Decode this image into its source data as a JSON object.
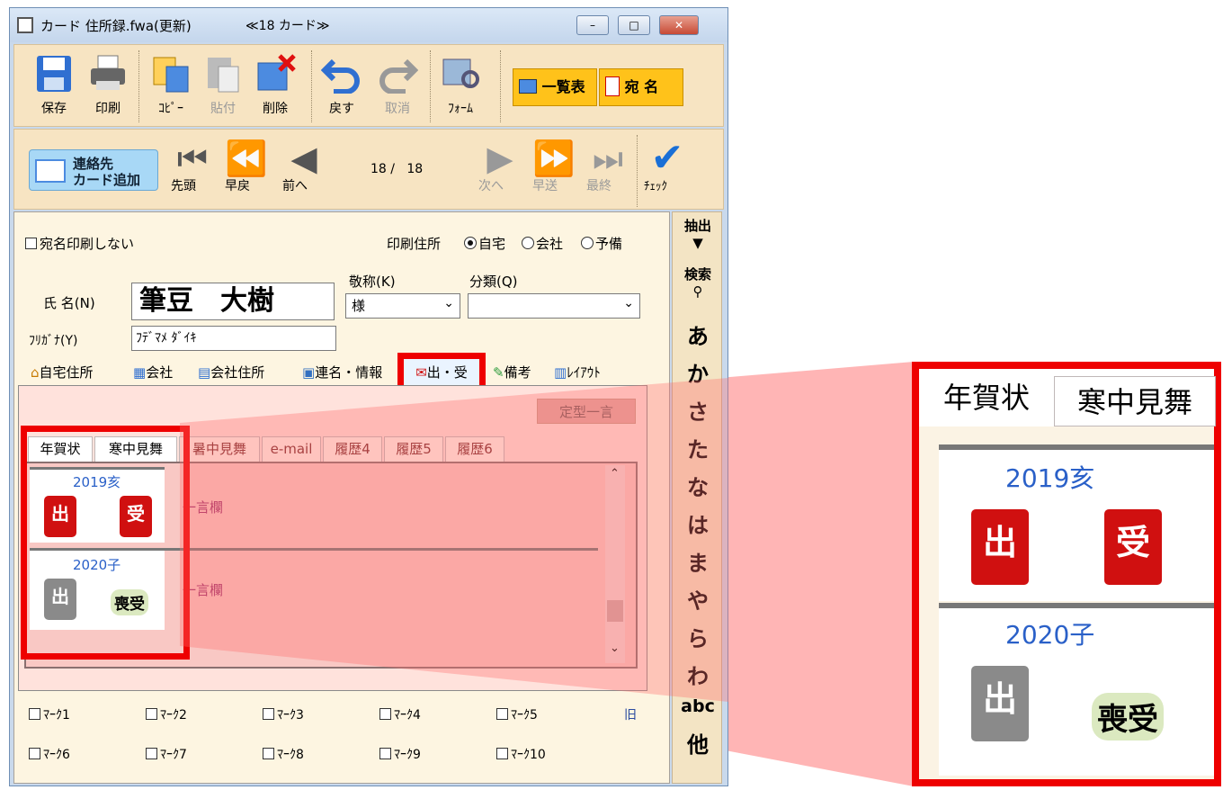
{
  "window": {
    "title": "カード 住所録.fwa(更新)",
    "card_count": "≪18 カード≫",
    "controls": [
      "–",
      "□",
      "✕"
    ]
  },
  "toolbar1": {
    "save": "保存",
    "print": "印刷",
    "copy": "ｺﾋﾟｰ",
    "paste": "貼付",
    "delete": "削除",
    "undo": "戻す",
    "redo": "取消",
    "form": "ﾌｫｰﾑ",
    "list": "一覧表",
    "address": "宛 名"
  },
  "toolbar2": {
    "add_contact_line1": "連絡先",
    "add_contact_line2": "カード追加",
    "first": "先頭",
    "fast_back": "早戻",
    "prev": "前へ",
    "position": "18 /   18",
    "next": "次へ",
    "fast_fwd": "早送",
    "last": "最終",
    "check": "ﾁｪｯｸ"
  },
  "form": {
    "no_print_label": "宛名印刷しない",
    "print_address_label": "印刷住所",
    "radio_home": "自宅",
    "radio_company": "会社",
    "radio_spare": "予備",
    "honorific_label": "敬称(K)",
    "category_label": "分類(Q)",
    "name_label": "氏 名(N)",
    "name_value": "筆豆　大樹",
    "honorific_value": "様",
    "category_value": "",
    "furigana_label": "ﾌﾘｶﾞﾅ(Y)",
    "furigana_value": "ﾌﾃﾞﾏﾒ ﾀﾞｲｷ"
  },
  "tabs": [
    "自宅住所",
    "会社",
    "会社住所",
    "連名・情報",
    "出・受",
    "備考",
    "ﾚｲｱｳﾄ"
  ],
  "fixed_phrase_button": "定型一言",
  "subtabs": [
    "年賀状",
    "寒中見舞",
    "暑中見舞",
    "e-mail",
    "履歴4",
    "履歴5",
    "履歴6"
  ],
  "records": [
    {
      "year": "2019亥",
      "sent": "出",
      "received": "受",
      "note": "一言欄"
    },
    {
      "year": "2020子",
      "sent": "出",
      "received": "喪受",
      "note": "一言欄"
    }
  ],
  "marks": [
    "ﾏｰｸ1",
    "ﾏｰｸ2",
    "ﾏｰｸ3",
    "ﾏｰｸ4",
    "ﾏｰｸ5",
    "ﾏｰｸ6",
    "ﾏｰｸ7",
    "ﾏｰｸ8",
    "ﾏｰｸ9",
    "ﾏｰｸ10"
  ],
  "marks_icon": "旧",
  "sidebar": {
    "extract": "抽出",
    "search": "検索",
    "kana": [
      "あ",
      "か",
      "さ",
      "た",
      "な",
      "は",
      "ま",
      "や",
      "ら",
      "わ",
      "abc",
      "他"
    ]
  },
  "zoom": {
    "tabs": [
      "年賀状",
      "寒中見舞"
    ],
    "year1": "2019亥",
    "year2": "2020子",
    "sent": "出",
    "received": "受",
    "mourning_received": "喪受"
  },
  "colors": {
    "highlight": "#ee0000",
    "overlay": "#ff6e6e",
    "toolbar": "#f7e4c2",
    "panel": "#fdf5e1",
    "postbox_red": "#d01010",
    "postbox_gray": "#8a8a8a"
  }
}
